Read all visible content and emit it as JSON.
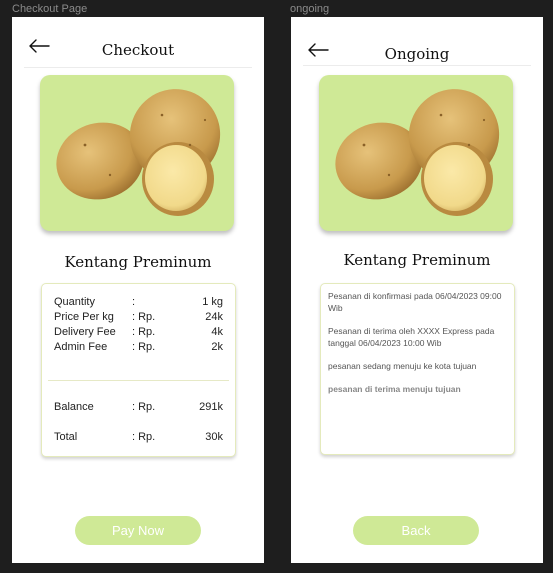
{
  "frames": {
    "checkout_label": "Checkout Page",
    "ongoing_label": "ongoing"
  },
  "checkout": {
    "title": "Checkout",
    "product_name": "Kentang Preminum",
    "rows": [
      {
        "label": "Quantity",
        "sep": ":",
        "value": "1 kg"
      },
      {
        "label": "Price Per kg",
        "sep": ": Rp.",
        "value": "24k"
      },
      {
        "label": "Delivery Fee",
        "sep": ": Rp.",
        "value": "4k"
      },
      {
        "label": "Admin Fee",
        "sep": ": Rp.",
        "value": "2k"
      }
    ],
    "balance": {
      "label": "Balance",
      "sep": ": Rp.",
      "value": "291k"
    },
    "total": {
      "label": "Total",
      "sep": ": Rp.",
      "value": "30k"
    },
    "button": "Pay Now"
  },
  "ongoing": {
    "title": "Ongoing",
    "product_name": "Kentang Preminum",
    "statuses": [
      "Pesanan di konfirmasi pada 06/04/2023 09:00 Wib",
      "Pesanan di terima oleh XXXX Express pada tanggal 06/04/2023 10:00 Wib",
      "pesanan sedang menuju ke kota tujuan",
      "pesanan di terima menuju tujuan"
    ],
    "button": "Back"
  },
  "colors": {
    "accent": "#cfe996",
    "background": "#1e1e1e",
    "card_border": "#e4eabc"
  },
  "icons": [
    "arrow-left-icon",
    "potato-image"
  ]
}
